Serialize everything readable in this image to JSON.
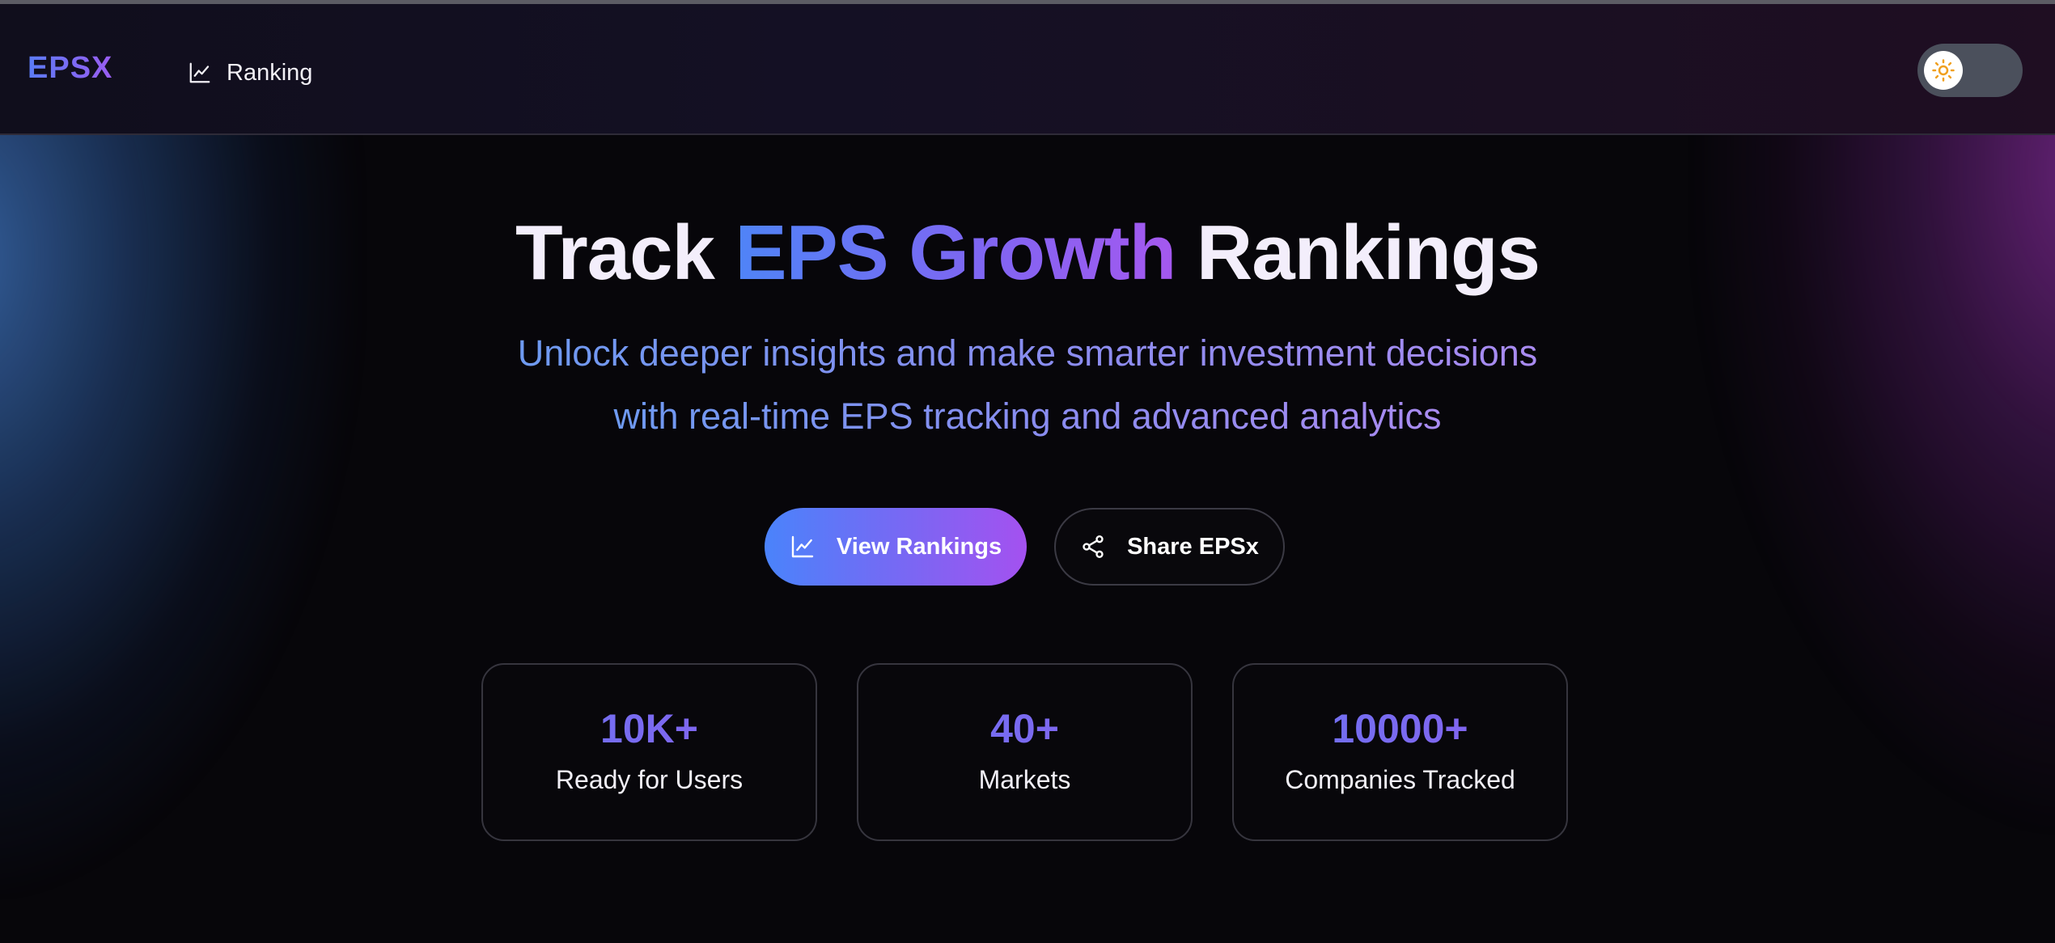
{
  "navbar": {
    "logo": "EPSX",
    "nav_items": [
      {
        "label": "Ranking",
        "icon": "line-chart-icon"
      }
    ],
    "theme_toggle": {
      "icon": "sun-icon",
      "state": "light"
    }
  },
  "hero": {
    "title_prefix": "Track",
    "title_highlight": "EPS Growth",
    "title_suffix": "Rankings",
    "subtitle_line1": "Unlock deeper insights and make smarter investment decisions",
    "subtitle_line2": "with real-time EPS tracking and advanced analytics"
  },
  "actions": {
    "primary": {
      "label": "View Rankings",
      "icon": "line-chart-icon"
    },
    "secondary": {
      "label": "Share EPSx",
      "icon": "share-icon"
    }
  },
  "stats": [
    {
      "value": "10K+",
      "caption": "Ready for Users"
    },
    {
      "value": "40+",
      "caption": "Markets"
    },
    {
      "value": "10000+",
      "caption": "Companies Tracked"
    }
  ],
  "colors": {
    "accent_blue": "#4a83fb",
    "accent_purple": "#a451f0",
    "background": "#07060a",
    "toggle_track": "#4b505c",
    "sun": "#f0a020"
  }
}
